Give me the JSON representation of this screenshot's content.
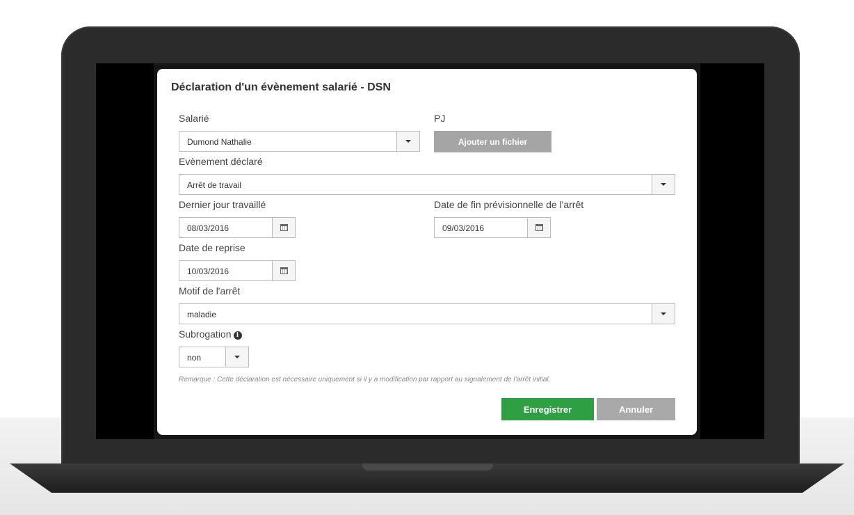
{
  "dialog": {
    "title": "Déclaration d'un évènement salarié - DSN",
    "salarie": {
      "label": "Salarié",
      "value": "Dumond Nathalie"
    },
    "pj": {
      "label": "PJ",
      "button_label": "Ajouter un fichier"
    },
    "evenement": {
      "label": "Evènement déclaré",
      "value": "Arrêt de travail"
    },
    "dernier_jour": {
      "label": "Dernier jour travaillé",
      "value": "08/03/2016"
    },
    "date_fin": {
      "label": "Date de fin prévisionnelle de l'arrêt",
      "value": "09/03/2016"
    },
    "date_reprise": {
      "label": "Date de reprise",
      "value": "10/03/2016"
    },
    "motif": {
      "label": "Motif de l'arrêt",
      "value": "maladie"
    },
    "subrogation": {
      "label": "Subrogation",
      "value": "non"
    },
    "remark": "Remarque : Cette déclaration est nécessaire uniquement si il y a modification par rapport au signalement de l'arrêt initial.",
    "save_label": "Enregistrer",
    "cancel_label": "Annuler"
  },
  "colors": {
    "save": "#2ea043",
    "cancel": "#a9a9a9",
    "attach": "#a5a5a5"
  },
  "icons": [
    "chevron-down-icon",
    "calendar-icon",
    "info-icon"
  ]
}
